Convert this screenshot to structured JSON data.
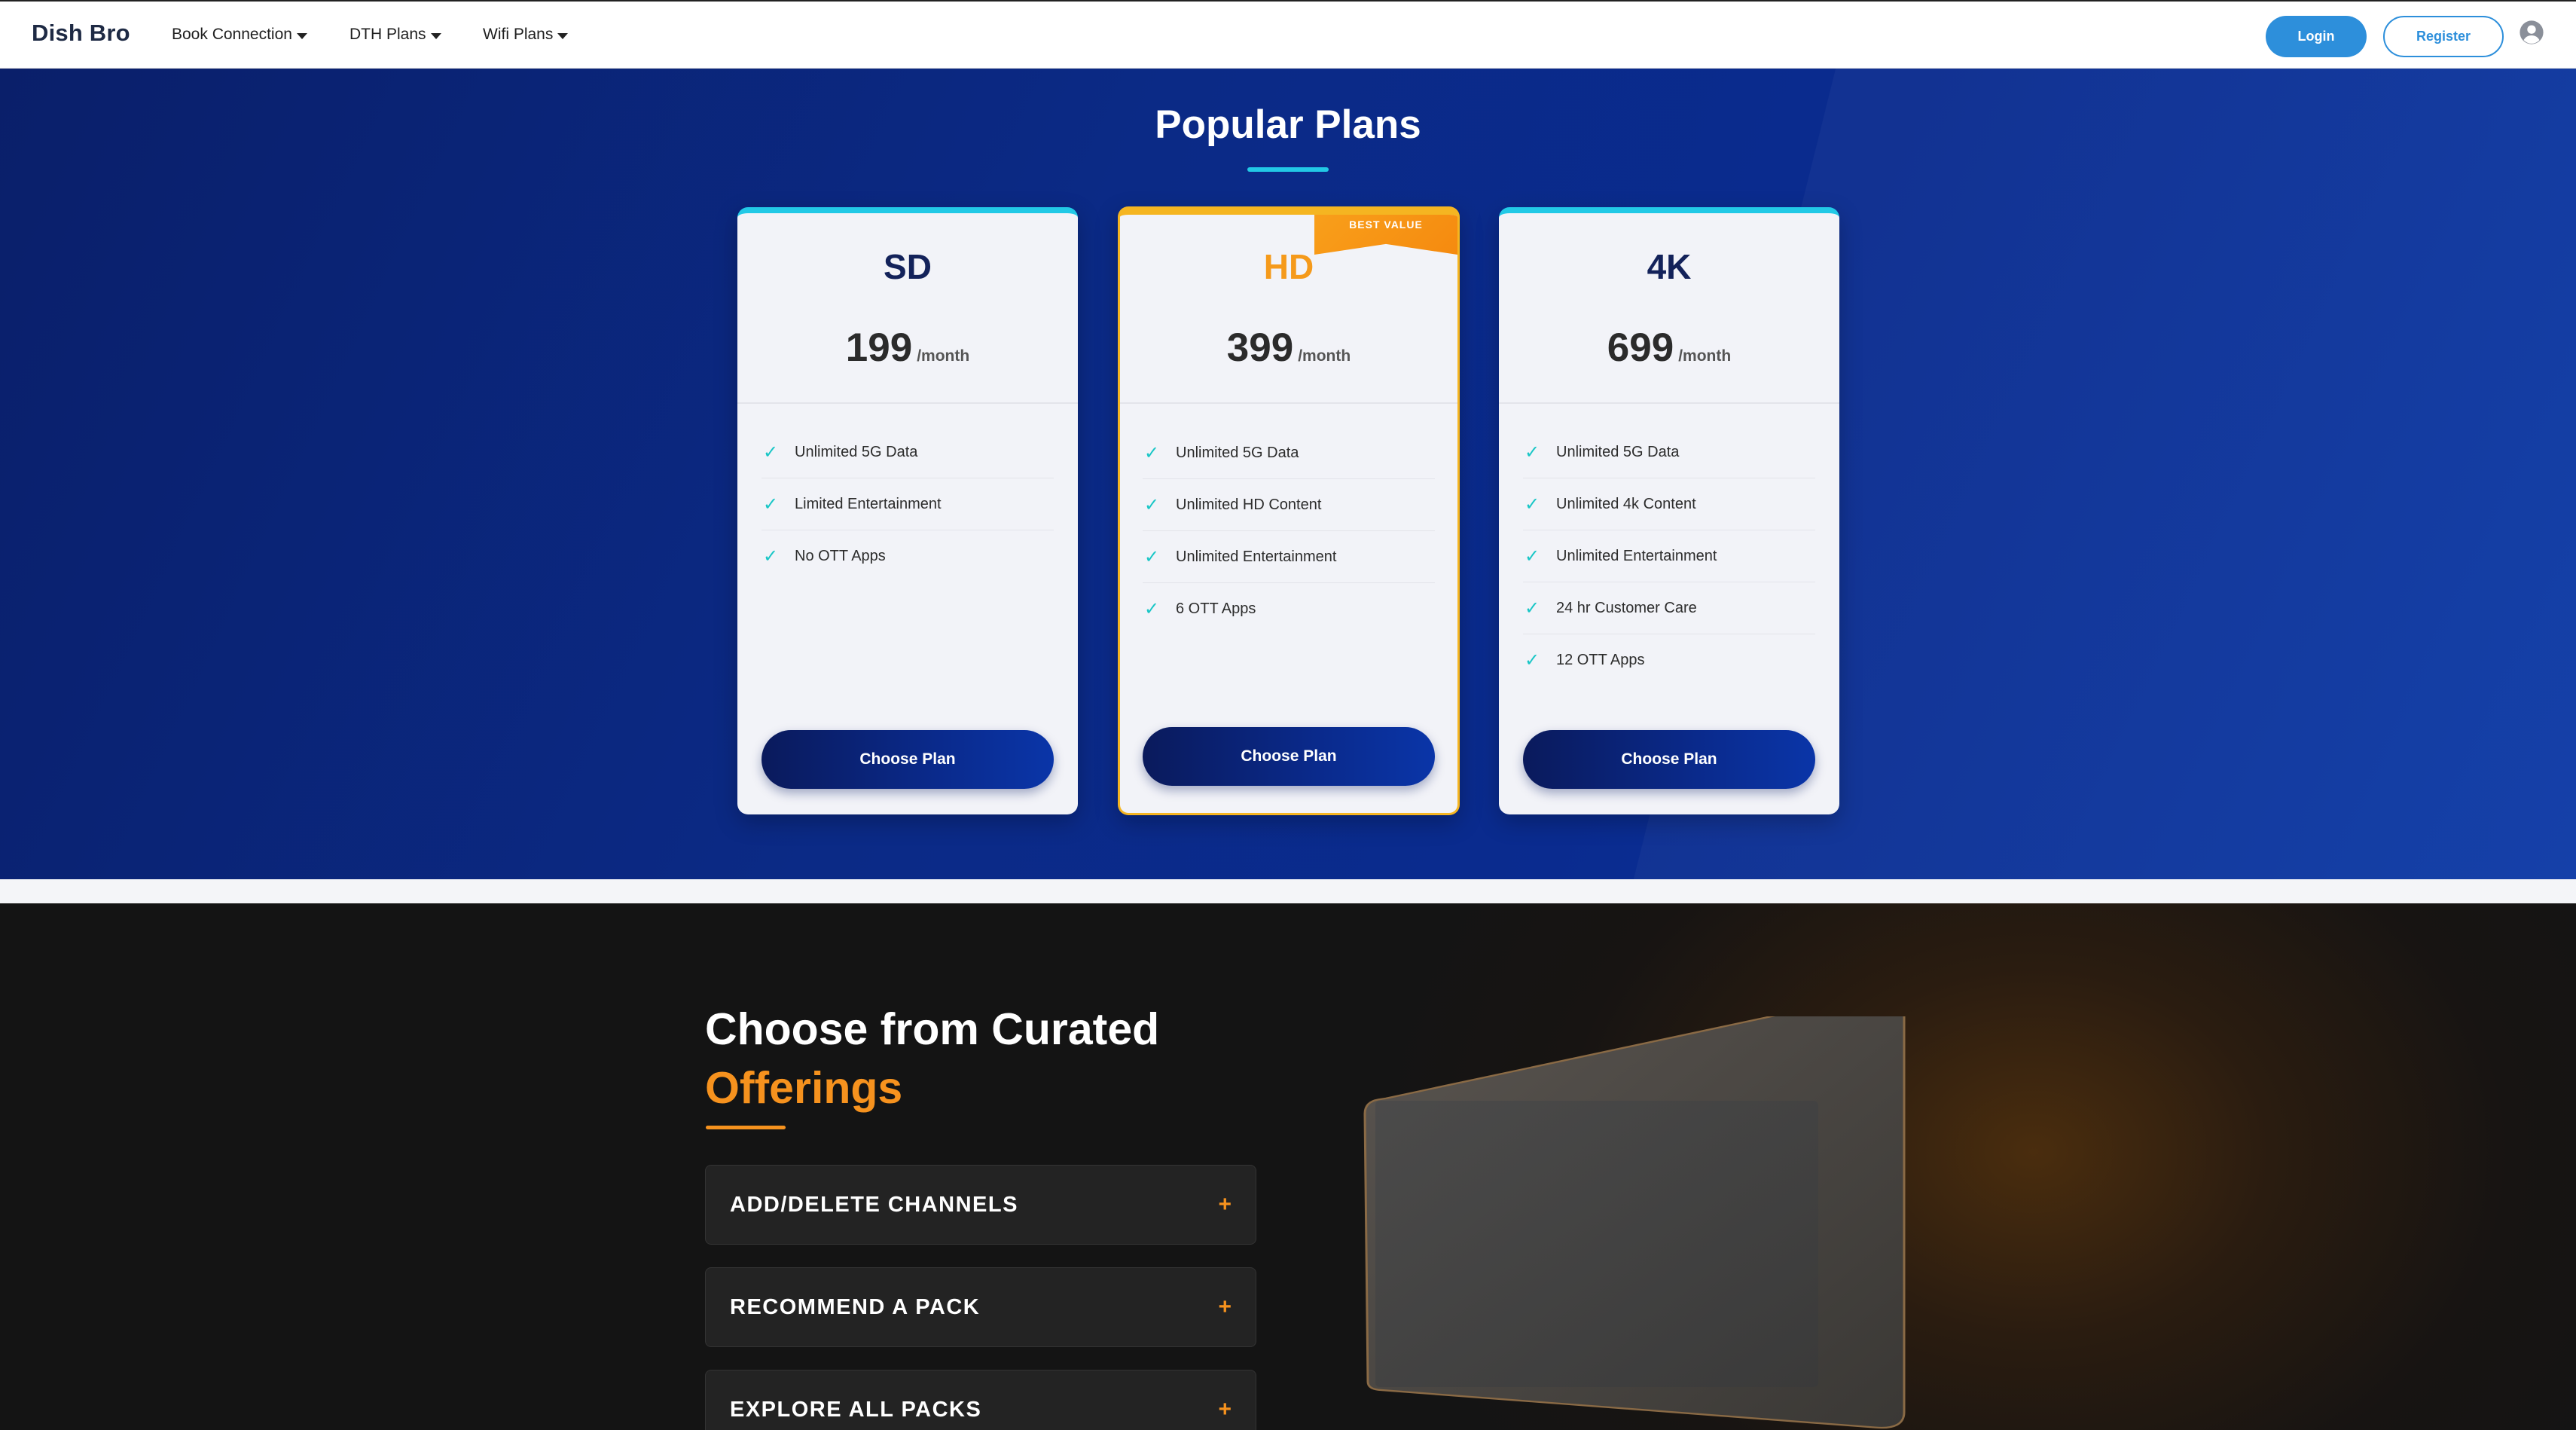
{
  "navbar": {
    "brand": "Dish Bro",
    "items": [
      {
        "label": "Book Connection"
      },
      {
        "label": "DTH Plans"
      },
      {
        "label": "Wifi Plans"
      }
    ],
    "login_label": "Login",
    "register_label": "Register",
    "user_icon": "user-circle-icon"
  },
  "plans": {
    "title": "Popular Plans",
    "cards": [
      {
        "name": "SD",
        "price": "199",
        "period": "/month",
        "features": [
          "Unlimited 5G Data",
          "Limited Entertainment",
          "No OTT Apps"
        ],
        "button": "Choose Plan"
      },
      {
        "name": "HD",
        "price": "399",
        "period": "/month",
        "badge": "BEST VALUE",
        "features": [
          "Unlimited 5G Data",
          "Unlimited HD Content",
          "Unlimited Entertainment",
          "6 OTT Apps"
        ],
        "button": "Choose Plan"
      },
      {
        "name": "4K",
        "price": "699",
        "period": "/month",
        "features": [
          "Unlimited 5G Data",
          "Unlimited 4k Content",
          "Unlimited Entertainment",
          "24 hr Customer Care",
          "12 OTT Apps"
        ],
        "button": "Choose Plan"
      }
    ],
    "check_icon": "checkmark-icon",
    "colors": {
      "accent_cyan": "#22c9e6",
      "featured_orange": "#f59a1b",
      "navy": "#0a2a8c"
    }
  },
  "curated": {
    "title_line1": "Choose from Curated",
    "title_line2": "Offerings",
    "accordion": [
      {
        "label": "ADD/DELETE CHANNELS"
      },
      {
        "label": "RECOMMEND A PACK"
      },
      {
        "label": "EXPLORE ALL PACKS"
      }
    ],
    "plus_symbol": "+",
    "colors": {
      "accent": "#f6921e"
    }
  }
}
